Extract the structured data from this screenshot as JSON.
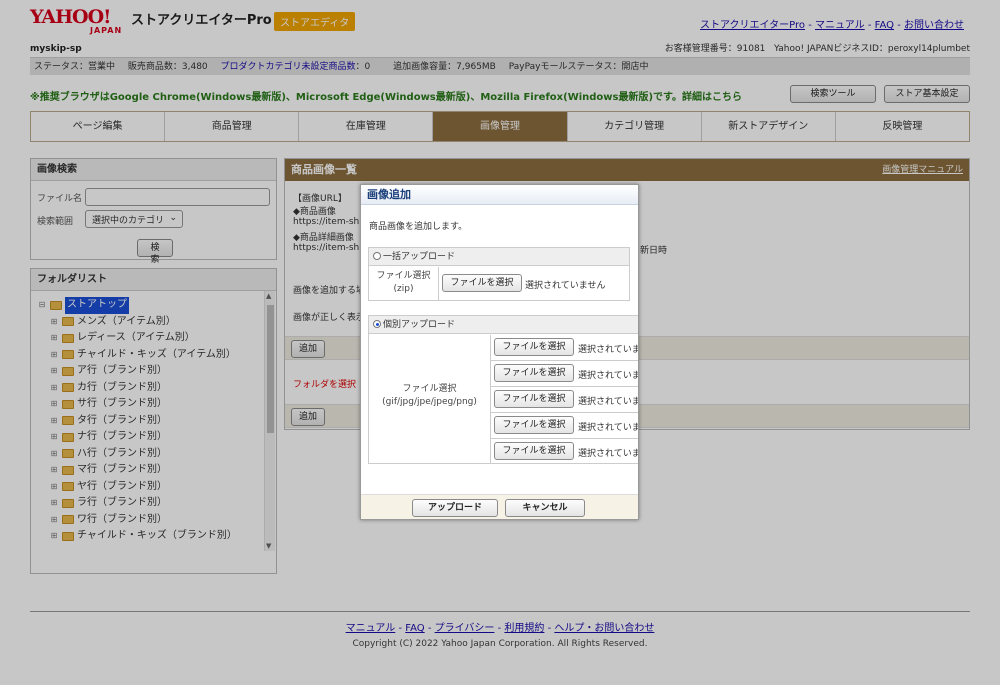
{
  "header": {
    "logo_main": "YAHOO!",
    "logo_sub": "JAPAN",
    "app_title": "ストアクリエイターPro",
    "badge": "ストアエディタ",
    "links": [
      "ストアクリエイターPro",
      "マニュアル",
      "FAQ",
      "お問い合わせ"
    ]
  },
  "store": {
    "id": "myskip-sp",
    "customer_no": "お客様管理番号：91081",
    "business_id": "Yahoo! JAPANビジネスID：peroxyl14plumbet",
    "status": "ステータス：営業中",
    "products": "販売商品数：3,480",
    "unset_link": "プロダクトカテゴリ未設定商品数",
    "unset_count": "：0",
    "capacity": "追加画像容量：7,965MB",
    "paypay": "PayPayモールステータス：開店中"
  },
  "browser_note": "※推奨ブラウザはGoogle Chrome(Windows最新版)、Microsoft Edge(Windows最新版)、Mozilla Firefox(Windows最新版)です。詳細はこちら",
  "top_buttons": [
    "検索ツール",
    "ストア基本設定"
  ],
  "tabs": [
    "ページ編集",
    "商品管理",
    "在庫管理",
    "画像管理",
    "カテゴリ管理",
    "新ストアデザイン",
    "反映管理"
  ],
  "search": {
    "title": "画像検索",
    "filename_label": "ファイル名",
    "range_label": "検索範囲",
    "range_value": "選択中のカテゴリ",
    "button": "検索"
  },
  "folders": {
    "title": "フォルダリスト",
    "root": "ストアトップ",
    "items": [
      "メンズ（アイテム別）",
      "レディース（アイテム別）",
      "チャイルド・キッズ（アイテム別）",
      "ア行（ブランド別）",
      "カ行（ブランド別）",
      "サ行（ブランド別）",
      "タ行（ブランド別）",
      "ナ行（ブランド別）",
      "ハ行（ブランド別）",
      "マ行（ブランド別）",
      "ヤ行（ブランド別）",
      "ラ行（ブランド別）",
      "ワ行（ブランド別）",
      "チャイルド・キッズ（ブランド別）"
    ]
  },
  "main": {
    "title": "商品画像一覧",
    "manual_link": "画像管理マニュアル",
    "url_head": "【画像URL】",
    "item_image": "◆商品画像",
    "url1": "https://item-sh",
    "detail_image": "◆商品詳細画像",
    "url2": "https://item-sh",
    "date_tail": "新日時",
    "note1": "画像を追加する場",
    "note2": "画像が正しく表示",
    "add_button": "追加",
    "warn": "フォルダを選択"
  },
  "dialog": {
    "title": "画像追加",
    "desc": "商品画像を追加します。",
    "bulk_label": "一括アップロード",
    "zip_label_1": "ファイル選択",
    "zip_label_2": "(zip)",
    "choose_file": "ファイルを選択",
    "no_file": "選択されていません",
    "no_file_cut": "選択されていま",
    "single_label": "個別アップロード",
    "img_label_1": "ファイル選択",
    "img_label_2": "(gif/jpg/jpe/jpeg/png)",
    "upload": "アップロード",
    "cancel": "キャンセル"
  },
  "footer": {
    "links": [
      "マニュアル",
      "FAQ",
      "プライバシー",
      "利用規約",
      "ヘルプ・お問い合わせ"
    ],
    "copyright": "Copyright (C) 2022 Yahoo Japan Corporation. All Rights Reserved."
  }
}
